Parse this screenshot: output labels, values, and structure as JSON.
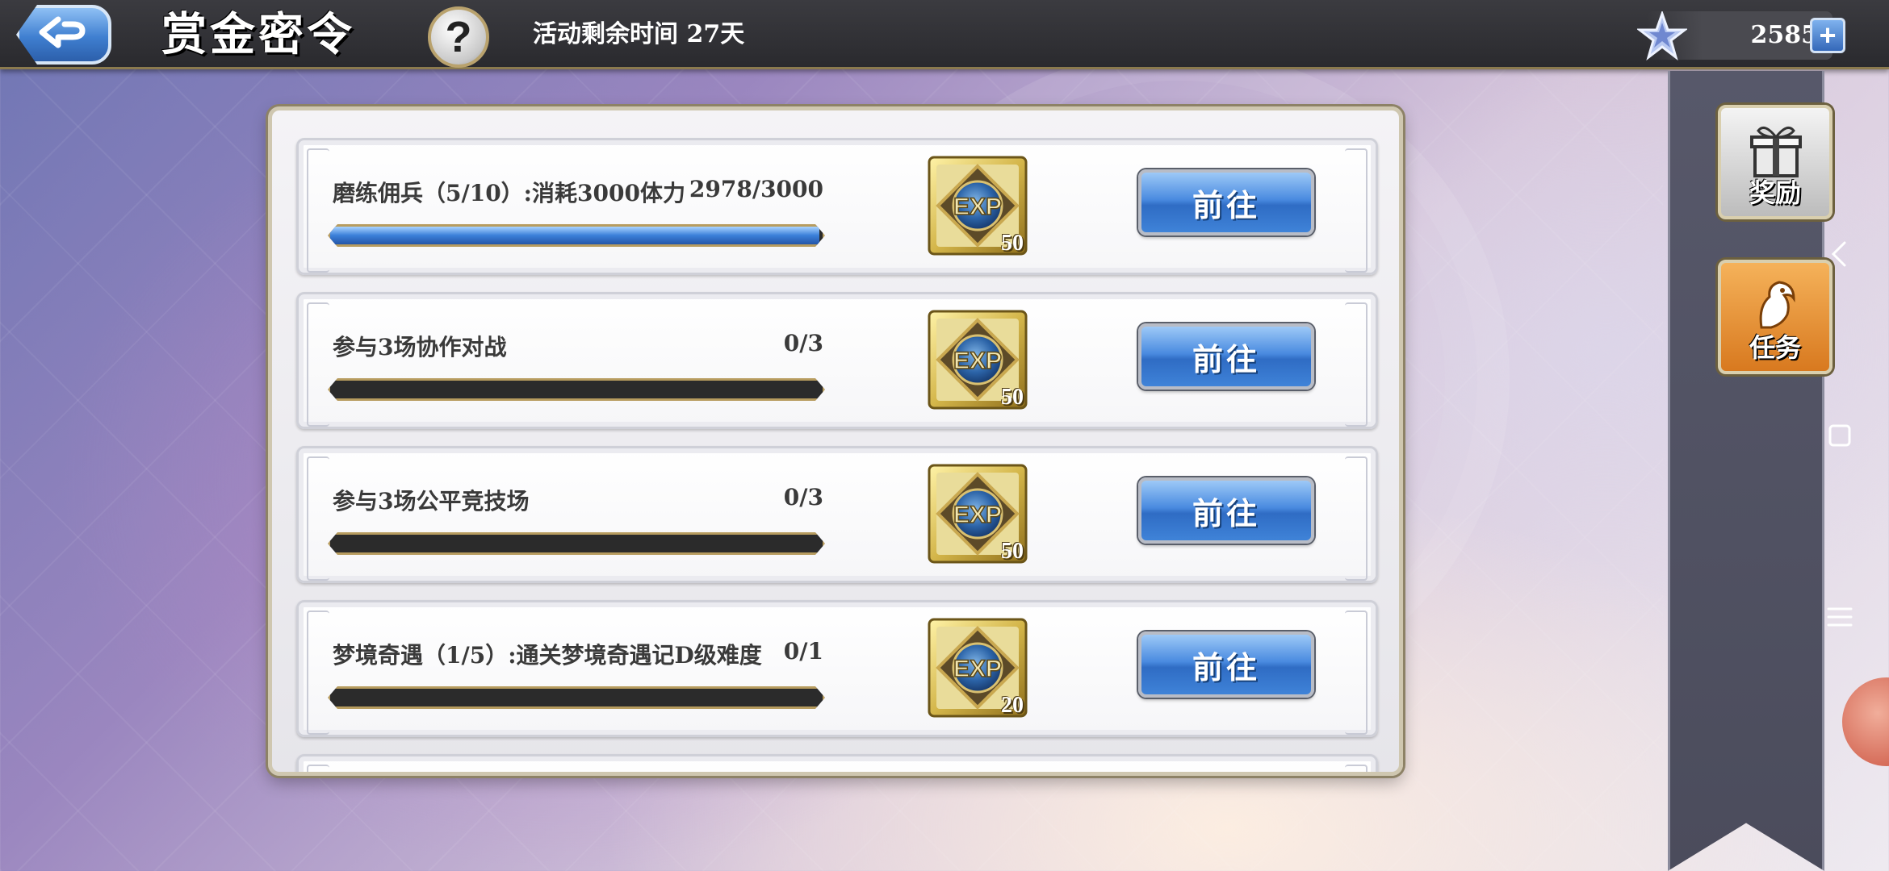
{
  "header": {
    "title": "赏金密令",
    "help_label": "?",
    "timer": "活动剩余时间  27天",
    "currency_value": "2585",
    "currency_icon": "star-icon",
    "plus_label": "+"
  },
  "tasks": [
    {
      "name": "磨练佣兵（5/10）:消耗3000体力",
      "progress_text": "2978/3000",
      "progress_fraction": 0.993,
      "reward_icon": "exp-medal-icon",
      "reward_count": "50",
      "button_label": "前往"
    },
    {
      "name": "参与3场协作对战",
      "progress_text": "0/3",
      "progress_fraction": 0,
      "reward_icon": "exp-medal-icon",
      "reward_count": "50",
      "button_label": "前往"
    },
    {
      "name": "参与3场公平竞技场",
      "progress_text": "0/3",
      "progress_fraction": 0,
      "reward_icon": "exp-medal-icon",
      "reward_count": "50",
      "button_label": "前往"
    },
    {
      "name": "梦境奇遇（1/5）:通关梦境奇遇记D级难度",
      "progress_text": "0/1",
      "progress_fraction": 0,
      "reward_icon": "exp-medal-icon",
      "reward_count": "20",
      "button_label": "前往"
    }
  ],
  "sidebar": {
    "reward_label": "奖励",
    "task_label": "任务"
  },
  "colors": {
    "accent_blue": "#3f83d8",
    "topbar": "#2f2f33",
    "task_tab": "#e38a2b"
  }
}
